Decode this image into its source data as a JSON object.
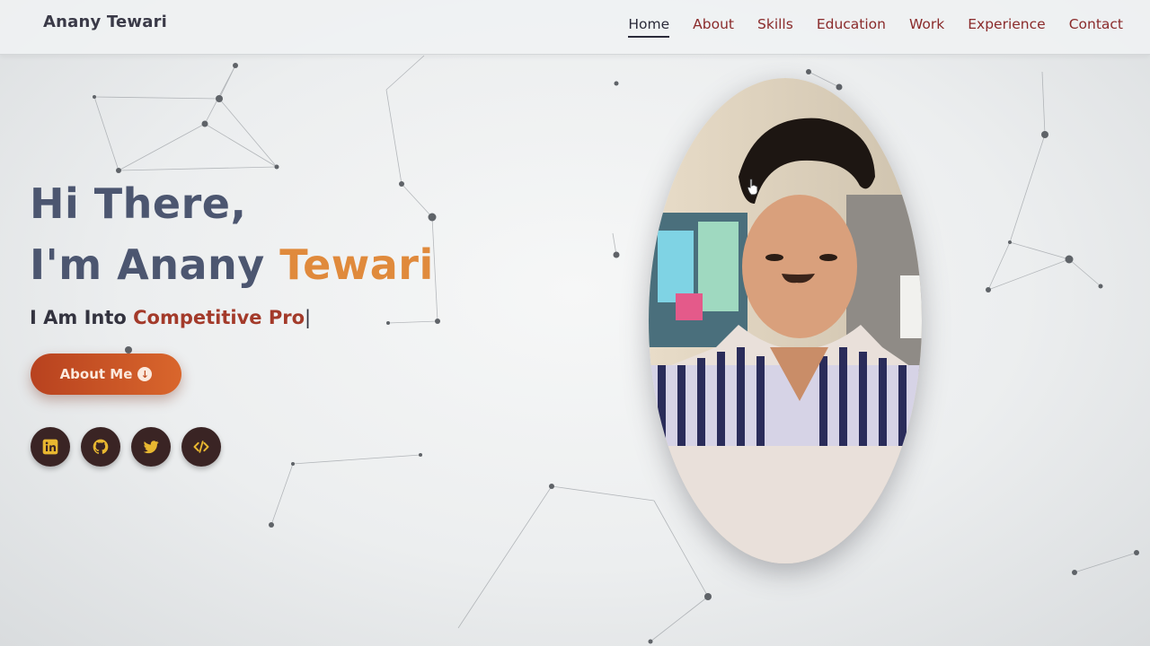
{
  "nav": {
    "brand": "Anany Tewari",
    "links": [
      {
        "label": "Home"
      },
      {
        "label": "About"
      },
      {
        "label": "Skills"
      },
      {
        "label": "Education"
      },
      {
        "label": "Work"
      },
      {
        "label": "Experience"
      },
      {
        "label": "Contact"
      }
    ],
    "active": "Home"
  },
  "hero": {
    "greeting": "Hi There,",
    "intro_prefix": "I'm Anany ",
    "intro_highlight": "Tewari",
    "typed_prefix": "I Am Into ",
    "typed_text": "Competitive Pro",
    "caret": "|",
    "button_label": "About Me"
  },
  "socials": [
    {
      "icon": "linkedin-icon"
    },
    {
      "icon": "github-icon"
    },
    {
      "icon": "twitter-icon"
    },
    {
      "icon": "code-icon"
    }
  ],
  "colors": {
    "accent_orange": "#e08a3c",
    "typed_red": "#a33a2a",
    "button_gradient_start": "#b8421f",
    "button_gradient_end": "#d9662c",
    "social_bg": "#3a2424",
    "social_icon": "#e8b730",
    "nav_link": "#8a2b2b"
  }
}
